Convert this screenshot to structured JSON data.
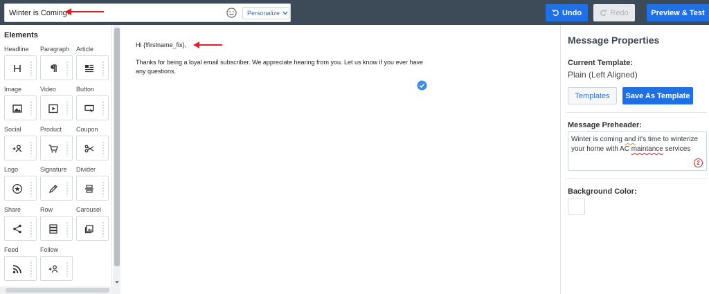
{
  "topbar": {
    "subject_value": "Winter is Coming!",
    "personalize_label": "Personalize",
    "undo_label": "Undo",
    "redo_label": "Redo",
    "preview_label": "Preview & Test"
  },
  "elements_panel": {
    "title": "Elements",
    "items": [
      {
        "label": "Headline",
        "icon": "headline-icon"
      },
      {
        "label": "Paragraph",
        "icon": "paragraph-icon"
      },
      {
        "label": "Article",
        "icon": "article-icon"
      },
      {
        "label": "Image",
        "icon": "image-icon"
      },
      {
        "label": "Video",
        "icon": "video-icon"
      },
      {
        "label": "Button",
        "icon": "button-icon"
      },
      {
        "label": "Social",
        "icon": "social-icon"
      },
      {
        "label": "Product",
        "icon": "cart-icon"
      },
      {
        "label": "Coupon",
        "icon": "scissors-icon"
      },
      {
        "label": "Logo",
        "icon": "logo-star-icon"
      },
      {
        "label": "Signature",
        "icon": "pen-icon"
      },
      {
        "label": "Divider",
        "icon": "divider-icon"
      },
      {
        "label": "Share",
        "icon": "share-icon"
      },
      {
        "label": "Row",
        "icon": "row-icon"
      },
      {
        "label": "Carousel",
        "icon": "carousel-icon"
      },
      {
        "label": "Feed",
        "icon": "rss-icon"
      },
      {
        "label": "Follow",
        "icon": "follow-icon"
      }
    ]
  },
  "canvas": {
    "greeting": "Hi {!firstname_fix},",
    "body": "Thanks for being a loyal email subscriber. We appreciate hearing from you. Let us know if you ever have any questions."
  },
  "properties": {
    "title": "Message Properties",
    "current_template_label": "Current Template:",
    "current_template_value": "Plain (Left Aligned)",
    "templates_button": "Templates",
    "save_template_button": "Save As Template",
    "preheader_label": "Message Preheader:",
    "preheader_parts": [
      "Winter is coming ",
      "and",
      " it's time to winterize your home with AC ",
      "maintance",
      " services"
    ],
    "preheader_error_count": "2",
    "background_label": "Background Color:",
    "background_color": "#ffffff"
  },
  "colors": {
    "topbar": "#3d4b59",
    "accent": "#1f6fe5",
    "annotation_arrow": "#e11d2a"
  }
}
